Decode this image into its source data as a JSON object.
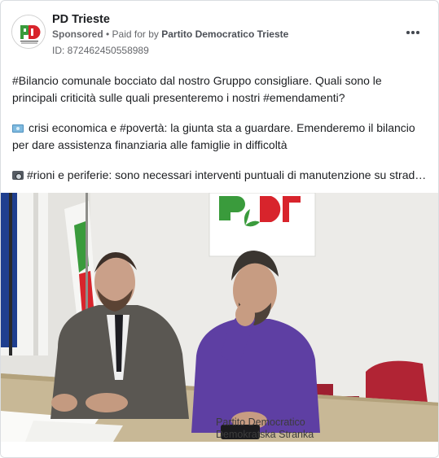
{
  "ad": {
    "page_name": "PD Trieste",
    "sponsored_label": "Sponsored",
    "separator": " • ",
    "paid_for_prefix": "Paid for by ",
    "advertiser": "Partito Democratico Trieste",
    "library_id": "ID: 872462450558989",
    "more_icon": "more-horizontal-icon"
  },
  "post": {
    "paragraph1": "#Bilancio comunale bocciato dal nostro Gruppo consigliare. Quali sono le principali criticità sulle quali presenteremo i nostri #emendamenti?",
    "paragraph2_emoji": "money-icon",
    "paragraph2": "crisi economica e #povertà: la giunta sta a guardare. Emenderemo il bilancio per dare assistenza finanziaria alle famiglie in difficoltà",
    "paragraph3_emoji": "camera-icon",
    "paragraph3": "#rioni e periferie: sono necessari interventi puntuali di manutenzione su strade, marciapiedi e aree verdi"
  },
  "photo": {
    "logo_line1": "Partito Democratico",
    "logo_line2": "Demokratska Stranka"
  },
  "colors": {
    "pd_green": "#3a9b3c",
    "pd_red": "#d8242c",
    "muted_text": "#65676b",
    "border": "#dadde1"
  }
}
